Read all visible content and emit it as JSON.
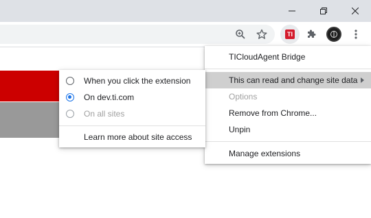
{
  "window_controls": {
    "minimize_icon": "minimize-icon",
    "restore_icon": "restore-icon",
    "close_icon": "close-icon"
  },
  "toolbar": {
    "icons": [
      "zoom-icon",
      "bookmark-star-icon",
      "ti-extension-icon",
      "extensions-puzzle-icon",
      "profile-avatar",
      "more-vert-icon"
    ],
    "ti_badge_text": "TI"
  },
  "colors": {
    "accent_blue": "#1a73e8",
    "ti_red": "#d41b2c",
    "page_band_red": "#cc0000",
    "page_band_gray": "#999999",
    "highlight": "#cfcfcf"
  },
  "extension_menu": {
    "title": "TICloudAgent Bridge",
    "items": [
      {
        "label": "This can read and change site data",
        "state": "highlighted",
        "has_submenu": true
      },
      {
        "label": "Options",
        "state": "disabled"
      },
      {
        "label": "Remove from Chrome...",
        "state": "enabled"
      },
      {
        "label": "Unpin",
        "state": "enabled"
      }
    ],
    "manage_label": "Manage extensions"
  },
  "site_access_menu": {
    "options": [
      {
        "label": "When you click the extension",
        "selected": false,
        "disabled": false
      },
      {
        "label": "On dev.ti.com",
        "selected": true,
        "disabled": false
      },
      {
        "label": "On all sites",
        "selected": false,
        "disabled": true
      }
    ],
    "learn_more_label": "Learn more about site access"
  }
}
